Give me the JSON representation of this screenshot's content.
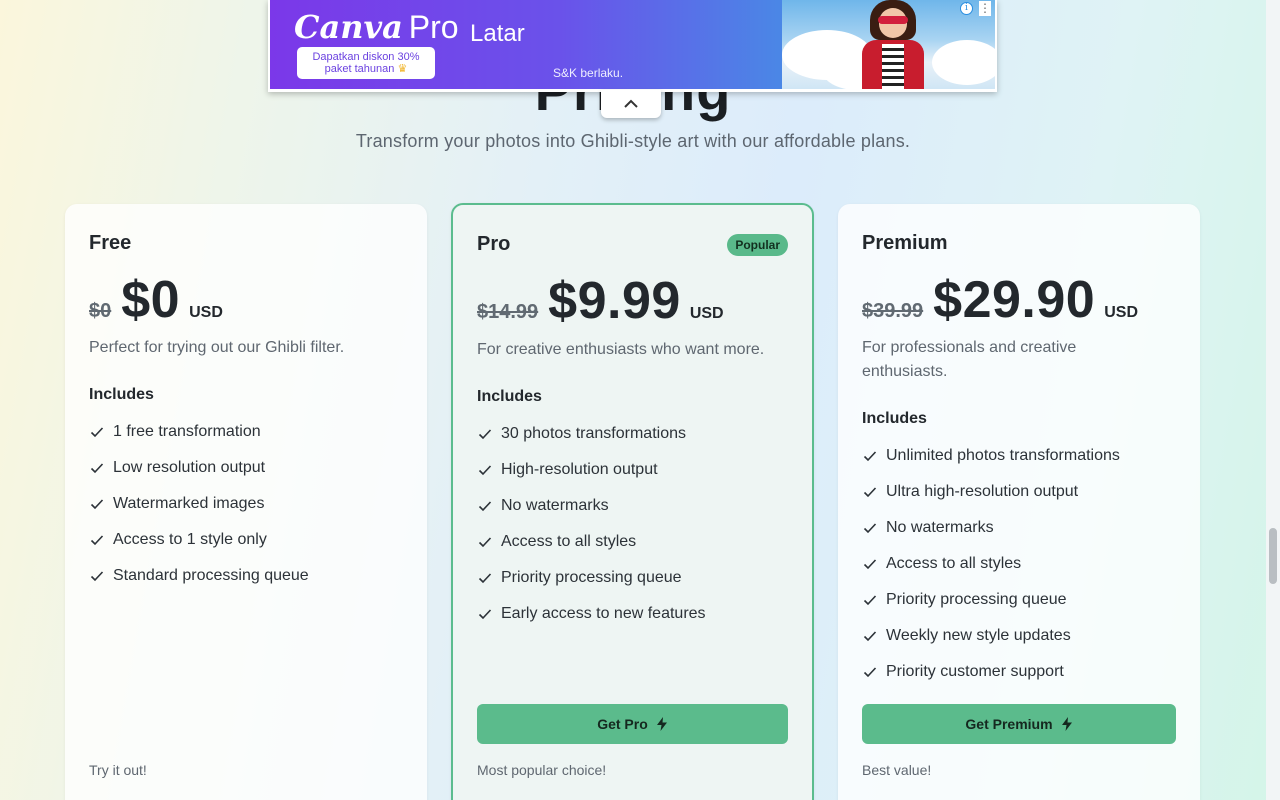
{
  "ad": {
    "brand": "Canva",
    "brand_suffix": "Pro",
    "promo_line1": "Dapatkan diskon 30%",
    "promo_line2": "paket tahunan",
    "headline": "Latar",
    "terms": "S&K berlaku.",
    "info_icon": "info-icon",
    "more_icon": "more-vertical-icon",
    "collapse_icon": "chevron-up-icon"
  },
  "hero": {
    "title": "Pricing",
    "subtitle": "Transform your photos into Ghibli-style art with our affordable plans."
  },
  "colors": {
    "accent": "#5bbb8c",
    "badge": "#59b98a",
    "pro_border": "#5bbc8e"
  },
  "plans": [
    {
      "name": "Free",
      "old_price": "$0",
      "price": "$0",
      "currency": "USD",
      "description": "Perfect for trying out our Ghibli filter.",
      "includes_label": "Includes",
      "features": [
        "1 free transformation",
        "Low resolution output",
        "Watermarked images",
        "Access to 1 style only",
        "Standard processing queue"
      ],
      "footer": "Try it out!"
    },
    {
      "name": "Pro",
      "badge": "Popular",
      "old_price": "$14.99",
      "price": "$9.99",
      "currency": "USD",
      "description": "For creative enthusiasts who want more.",
      "includes_label": "Includes",
      "features": [
        "30 photos transformations",
        "High-resolution output",
        "No watermarks",
        "Access to all styles",
        "Priority processing queue",
        "Early access to new features"
      ],
      "cta": "Get Pro",
      "footer": "Most popular choice!"
    },
    {
      "name": "Premium",
      "old_price": "$39.99",
      "price": "$29.90",
      "currency": "USD",
      "description": "For professionals and creative enthusiasts.",
      "includes_label": "Includes",
      "features": [
        "Unlimited photos transformations",
        "Ultra high-resolution output",
        "No watermarks",
        "Access to all styles",
        "Priority processing queue",
        "Weekly new style updates",
        "Priority customer support"
      ],
      "cta": "Get Premium",
      "footer": "Best value!"
    }
  ]
}
